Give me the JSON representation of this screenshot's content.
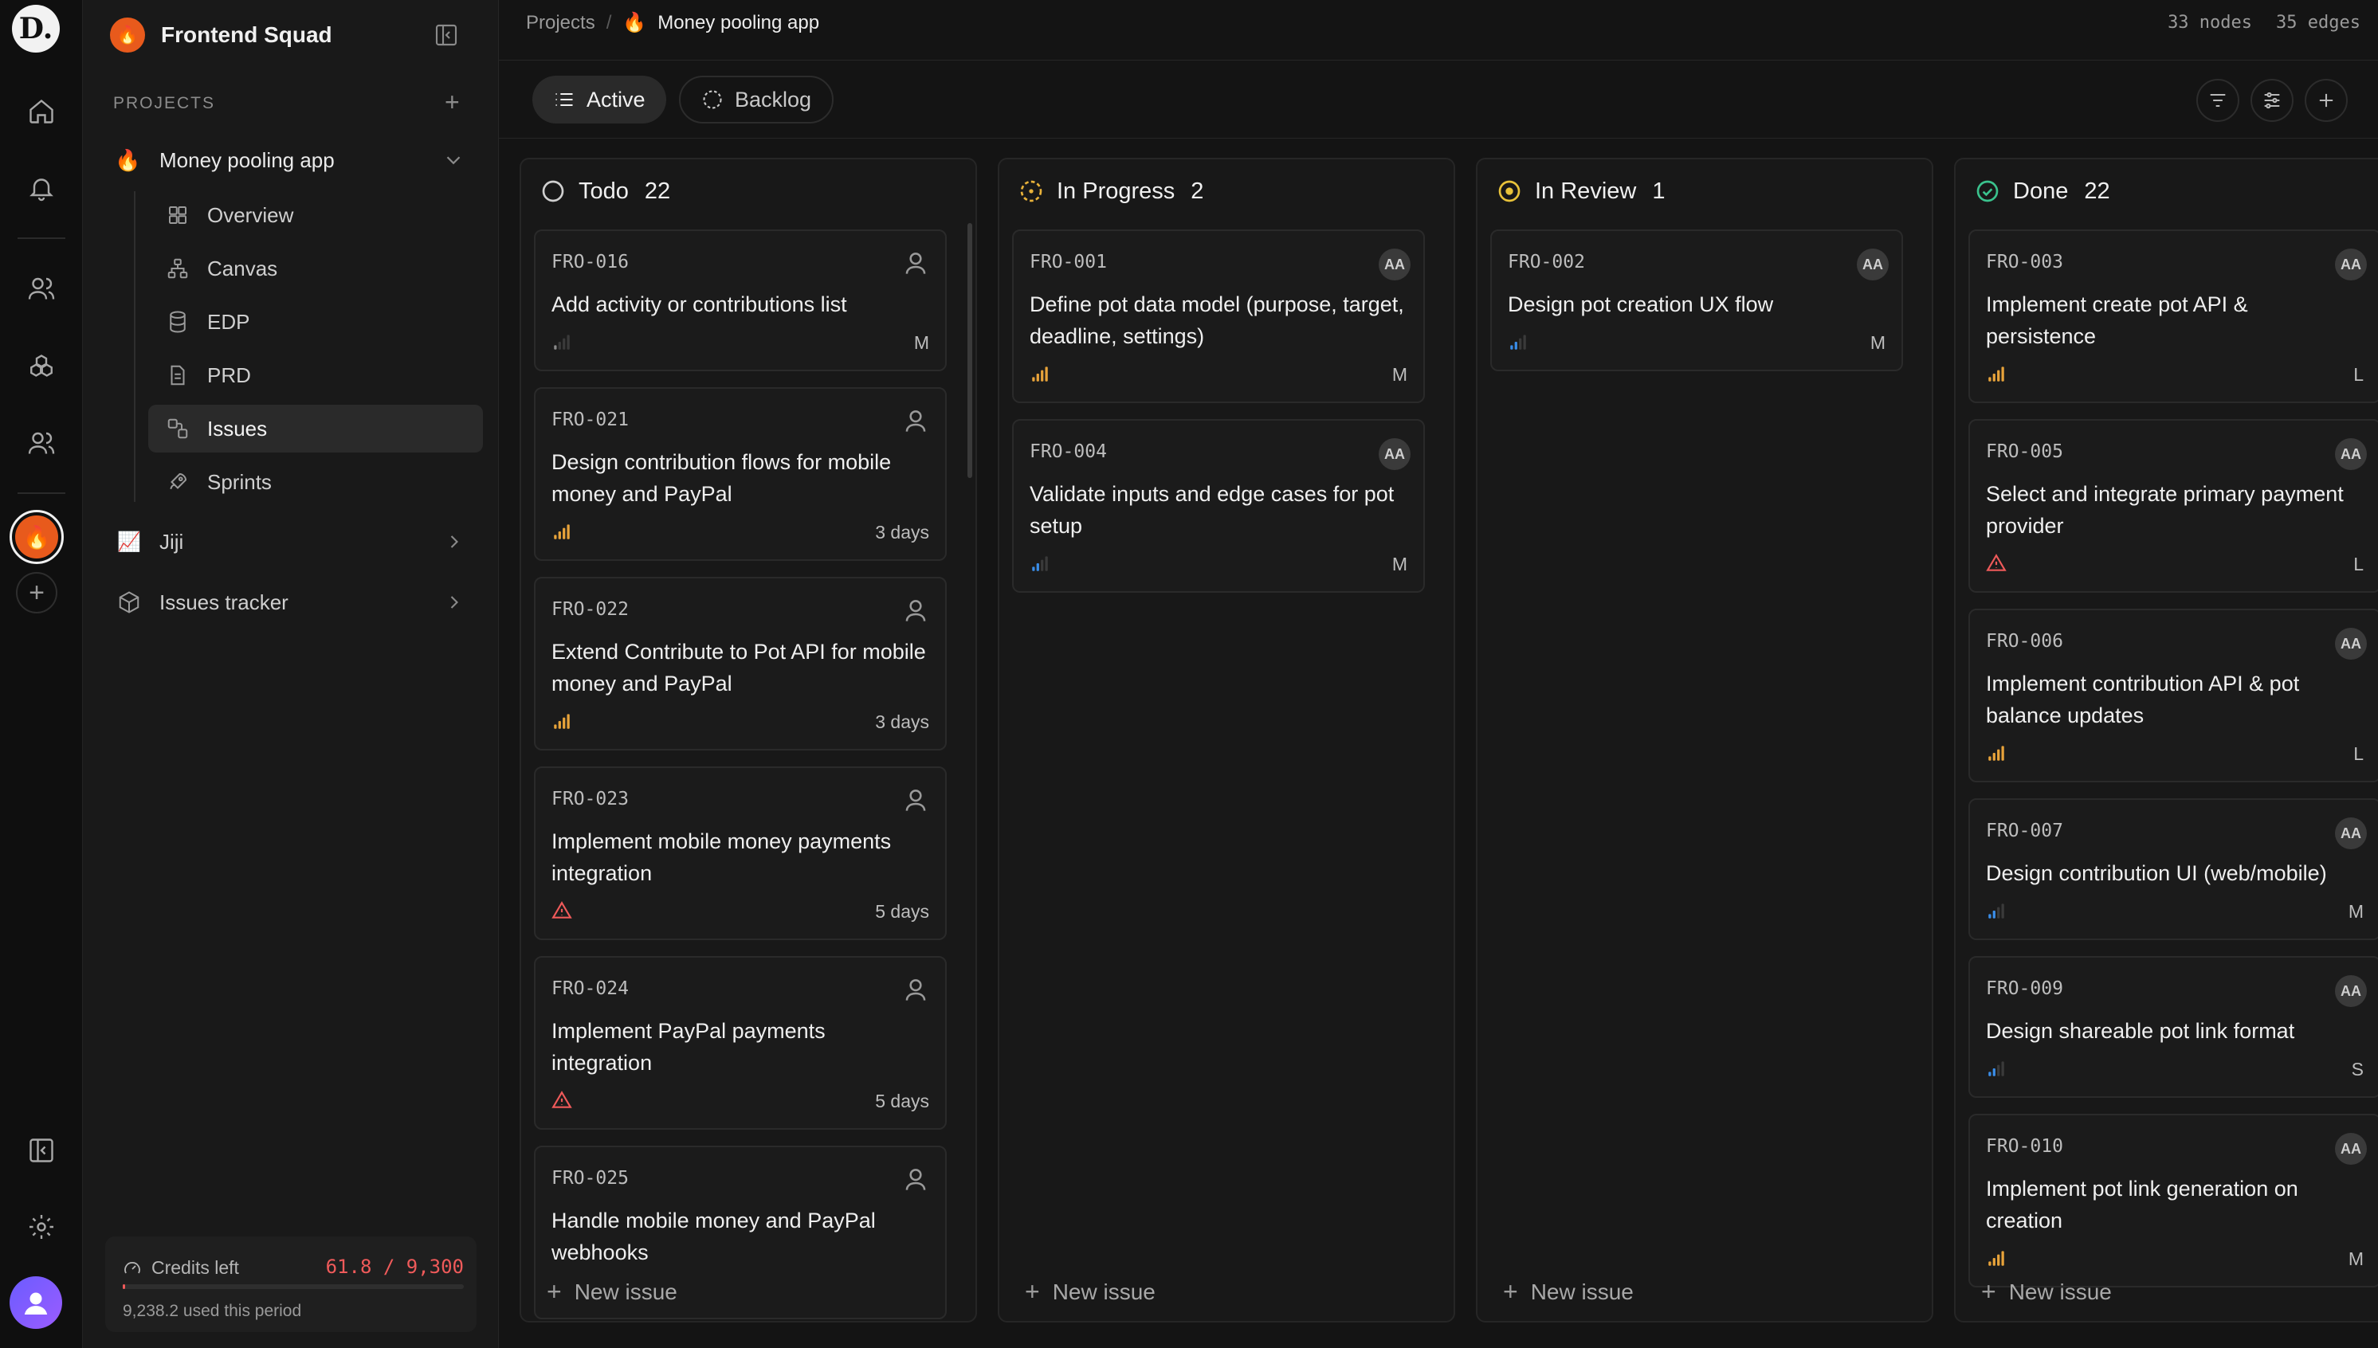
{
  "workspace": {
    "logo_letter": "D."
  },
  "team": {
    "name": "Frontend Squad",
    "icon": "fire-icon"
  },
  "sidebar": {
    "section_label": "PROJECTS",
    "current_project": "Money pooling app",
    "sub_items": [
      {
        "label": "Overview",
        "icon": "grid-icon"
      },
      {
        "label": "Canvas",
        "icon": "nodes-icon"
      },
      {
        "label": "EDP",
        "icon": "database-icon"
      },
      {
        "label": "PRD",
        "icon": "document-icon"
      },
      {
        "label": "Issues",
        "icon": "issues-icon",
        "active": true
      },
      {
        "label": "Sprints",
        "icon": "rocket-icon"
      }
    ],
    "other_projects": [
      {
        "label": "Jiji",
        "icon": "chart-icon"
      },
      {
        "label": "Issues tracker",
        "icon": "cube-icon"
      }
    ],
    "credits": {
      "label": "Credits left",
      "value": "61.8 / 9,300",
      "used": "9,238.2 used this period",
      "fraction_left": 0.0066
    }
  },
  "header": {
    "breadcrumb_root": "Projects",
    "breadcrumb_separator": "/",
    "breadcrumb_current": "Money pooling app",
    "nodes": "33 nodes",
    "edges": "35 edges"
  },
  "toolbar": {
    "tab_active": "Active",
    "tab_backlog": "Backlog"
  },
  "board": {
    "new_issue_label": "New issue",
    "columns": [
      {
        "name": "Todo",
        "count": "22",
        "status_icon": "todo-circle-icon",
        "cards": [
          {
            "id": "FRO-016",
            "title": "Add activity or contributions list",
            "priority": "low",
            "meta": "M",
            "assignee": ""
          },
          {
            "id": "FRO-021",
            "title": "Design contribution flows for mobile money and PayPal",
            "priority": "high",
            "meta": "3 days",
            "assignee": ""
          },
          {
            "id": "FRO-022",
            "title": "Extend Contribute to Pot API for mobile money and PayPal",
            "priority": "high",
            "meta": "3 days",
            "assignee": ""
          },
          {
            "id": "FRO-023",
            "title": "Implement mobile money payments integration",
            "priority": "urgent",
            "meta": "5 days",
            "assignee": ""
          },
          {
            "id": "FRO-024",
            "title": "Implement PayPal payments integration",
            "priority": "urgent",
            "meta": "5 days",
            "assignee": ""
          },
          {
            "id": "FRO-025",
            "title": "Handle mobile money and PayPal webhooks",
            "priority": "",
            "meta": "",
            "assignee": ""
          }
        ]
      },
      {
        "name": "In Progress",
        "count": "2",
        "status_icon": "in-progress-circle-icon",
        "cards": [
          {
            "id": "FRO-001",
            "title": "Define pot data model (purpose, target, deadline, settings)",
            "priority": "high",
            "meta": "M",
            "assignee": "AA"
          },
          {
            "id": "FRO-004",
            "title": "Validate inputs and edge cases for pot setup",
            "priority": "medium",
            "meta": "M",
            "assignee": "AA"
          }
        ]
      },
      {
        "name": "In Review",
        "count": "1",
        "status_icon": "in-review-circle-icon",
        "cards": [
          {
            "id": "FRO-002",
            "title": "Design pot creation UX flow",
            "priority": "medium",
            "meta": "M",
            "assignee": "AA"
          }
        ]
      },
      {
        "name": "Done",
        "count": "22",
        "status_icon": "done-check-icon",
        "cards": [
          {
            "id": "FRO-003",
            "title": "Implement create pot API & persistence",
            "priority": "high",
            "meta": "L",
            "assignee": "AA"
          },
          {
            "id": "FRO-005",
            "title": "Select and integrate primary payment provider",
            "priority": "urgent",
            "meta": "L",
            "assignee": "AA"
          },
          {
            "id": "FRO-006",
            "title": "Implement contribution API & pot balance updates",
            "priority": "high",
            "meta": "L",
            "assignee": "AA"
          },
          {
            "id": "FRO-007",
            "title": "Design contribution UI (web/mobile)",
            "priority": "medium",
            "meta": "M",
            "assignee": "AA"
          },
          {
            "id": "FRO-009",
            "title": "Design shareable pot link format",
            "priority": "medium",
            "meta": "S",
            "assignee": "AA"
          },
          {
            "id": "FRO-010",
            "title": "Implement pot link generation on creation",
            "priority": "high",
            "meta": "M",
            "assignee": "AA"
          }
        ]
      }
    ]
  },
  "colors": {
    "accent": "#e85a1c",
    "priority_high": "#e8a33a",
    "priority_medium": "#3a8de8",
    "priority_urgent": "#ef5a5a",
    "in_progress": "#e8b23a",
    "in_review": "#e8c23a",
    "done": "#3ac28d"
  }
}
